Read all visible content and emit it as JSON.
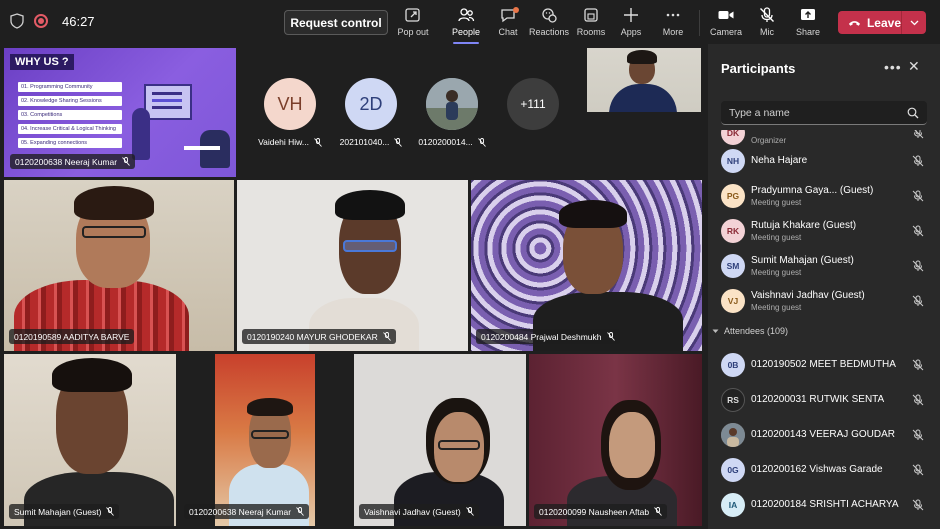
{
  "toolbar": {
    "timer": "46:27",
    "request_control": "Request control",
    "items": [
      {
        "label": "Pop out",
        "icon": "pop-out-icon"
      },
      {
        "label": "People",
        "icon": "people-icon"
      },
      {
        "label": "Chat",
        "icon": "chat-icon"
      },
      {
        "label": "Reactions",
        "icon": "reactions-icon"
      },
      {
        "label": "Rooms",
        "icon": "rooms-icon"
      },
      {
        "label": "Apps",
        "icon": "apps-icon"
      },
      {
        "label": "More",
        "icon": "more-icon"
      },
      {
        "label": "Camera",
        "icon": "camera-icon"
      },
      {
        "label": "Mic",
        "icon": "mic-off-icon"
      },
      {
        "label": "Share",
        "icon": "share-icon"
      }
    ],
    "leave": "Leave",
    "colors": {
      "leave": "#c4314b",
      "accent": "#7f85f5"
    }
  },
  "stage": {
    "share_tile": {
      "slide_title": "WHY US ?",
      "slide_items": [
        "01. Programming Community",
        "02. Knowledge Sharing Sessions",
        "03. Competitions",
        "04. Increase Critical & Logical Thinking",
        "05. Expanding connections"
      ],
      "name": "0120200638 Neeraj Kumar"
    },
    "avatars": [
      {
        "initials": "VH",
        "name": "Vaidehi Hiw...",
        "color": "#f4d7cc"
      },
      {
        "initials": "2D",
        "name": "202101040...",
        "color": "#cfd8f4"
      },
      {
        "initials": "",
        "name": "0120200014...",
        "color": "#8a9aa6"
      },
      {
        "initials": "+111",
        "name": "",
        "color": "#3d3d3d"
      }
    ],
    "tiles": [
      {
        "name": "0120190589 AADITYA BARVE"
      },
      {
        "name": "0120190240 MAYUR GHODEKAR"
      },
      {
        "name": "0120200484 Prajwal Deshmukh"
      },
      {
        "name": "Sumit Mahajan (Guest)"
      },
      {
        "name": "0120200638 Neeraj Kumar"
      },
      {
        "name": "Vaishnavi Jadhav (Guest)"
      },
      {
        "name": "0120200099 Nausheen Aftab"
      }
    ]
  },
  "panel": {
    "title": "Participants",
    "search_placeholder": "Type a name",
    "organizer_role": "Organizer",
    "presenters": [
      {
        "initials": "NH",
        "name": "Neha Hajare",
        "sub": "",
        "color": "#cfd8f4"
      },
      {
        "initials": "PG",
        "name": "Pradyumna Gaya... (Guest)",
        "sub": "Meeting guest",
        "color": "#fbe3c6"
      },
      {
        "initials": "RK",
        "name": "Rutuja Khakare (Guest)",
        "sub": "Meeting guest",
        "color": "#f3d2d6"
      },
      {
        "initials": "SM",
        "name": "Sumit Mahajan (Guest)",
        "sub": "Meeting guest",
        "color": "#cfd8f4"
      },
      {
        "initials": "VJ",
        "name": "Vaishnavi Jadhav (Guest)",
        "sub": "Meeting guest",
        "color": "#fbe3c6"
      }
    ],
    "attendees_header": "Attendees (109)",
    "attendees": [
      {
        "initials": "0B",
        "name": "0120190502 MEET BEDMUTHA",
        "color": "#cfd8f4"
      },
      {
        "initials": "RS",
        "name": "0120200031 RUTWIK SENTA",
        "color": "#222222"
      },
      {
        "initials": "",
        "name": "0120200143 VEERAJ GOUDAR",
        "color": "#8a7a6a"
      },
      {
        "initials": "0G",
        "name": "0120200162 Vishwas Garade",
        "color": "#cfd8f4"
      },
      {
        "initials": "IA",
        "name": "0120200184 SRISHTI ACHARYA",
        "color": "#d7edf6"
      }
    ]
  }
}
